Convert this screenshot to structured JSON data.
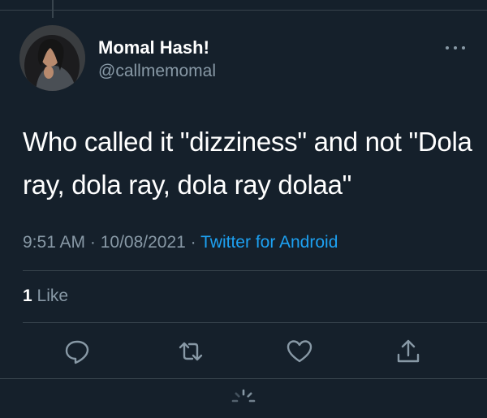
{
  "tweet": {
    "author": {
      "display_name": "Momal Hash!",
      "handle": "@callmemomal"
    },
    "text": "Who called it \"dizziness\" and not \"Dola ray, dola ray, dola ray dolaa\"",
    "time": "9:51 AM",
    "separator1": " · ",
    "date": "10/08/2021",
    "separator2": " · ",
    "source": "Twitter for Android",
    "likes": {
      "count": "1",
      "label": " Like"
    }
  },
  "icons": {
    "more": "more-horizontal-icon",
    "reply": "reply-icon",
    "retweet": "retweet-icon",
    "like": "heart-icon",
    "share": "share-icon",
    "loading": "loading-spinner-icon"
  },
  "colors": {
    "background": "#15202b",
    "accent": "#1da1f2",
    "secondary_text": "#8899a6",
    "divider": "#38444d"
  }
}
